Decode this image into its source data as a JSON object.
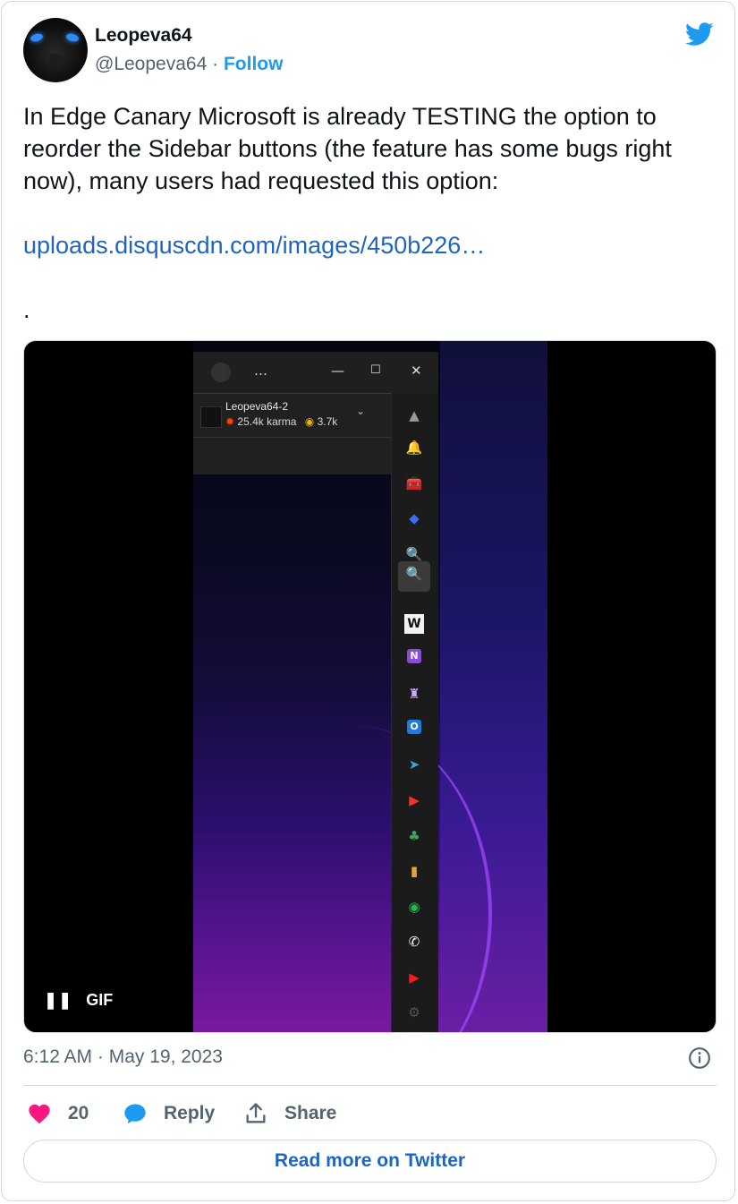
{
  "author": {
    "display_name": "Leopeva64",
    "handle": "@Leopeva64",
    "separator": "·",
    "follow_label": "Follow"
  },
  "tweet": {
    "text_line": "In Edge Canary Microsoft is already TESTING the option to reorder the Sidebar buttons (the feature has some bugs right now), many users had requested this option:",
    "link_text": "uploads.disquscdn.com/images/450b226…",
    "trailing": "."
  },
  "media": {
    "badge": "GIF",
    "pause_glyph": "❚❚",
    "edge": {
      "more_glyph": "…",
      "min_glyph": "—",
      "max_glyph": "☐",
      "close_glyph": "✕",
      "account_name": "Leopeva64-2",
      "karma": "25.4k karma",
      "coins": "3.7k",
      "karma_icon": "✹",
      "coins_icon": "◉",
      "chevron": "⌄",
      "sidebar_icons": [
        {
          "name": "scroll-up-icon",
          "glyph": "▲",
          "color": "#9a9a9a"
        },
        {
          "name": "notification-bell-icon",
          "glyph": "🔔",
          "color": "#2f8bff"
        },
        {
          "name": "tools-icon",
          "glyph": "🧰",
          "color": "#e87a2a"
        },
        {
          "name": "microsoft365-icon",
          "glyph": "◆",
          "color": "#3b6cf0"
        },
        {
          "name": "drag-search-icon",
          "glyph": "🔍",
          "color": "#c9c23a"
        },
        {
          "name": "search-icon",
          "glyph": "🔍",
          "color": "#b08cff"
        },
        {
          "name": "wordle-icon",
          "glyph": "W",
          "color": "#111111"
        },
        {
          "name": "onenote-icon",
          "glyph": "N",
          "color": "#8a4bd6"
        },
        {
          "name": "chess-icon",
          "glyph": "♜",
          "color": "#c9a8ff"
        },
        {
          "name": "outlook-icon",
          "glyph": "O",
          "color": "#1f7ae0"
        },
        {
          "name": "telegram-icon",
          "glyph": "➤",
          "color": "#3aa0e0"
        },
        {
          "name": "youtube-music-icon",
          "glyph": "▶",
          "color": "#ff2d2d"
        },
        {
          "name": "tree-icon",
          "glyph": "♣",
          "color": "#3aa55a"
        },
        {
          "name": "deezer-icon",
          "glyph": "▮",
          "color": "#e8a33a"
        },
        {
          "name": "spotify-icon",
          "glyph": "◉",
          "color": "#1db954"
        },
        {
          "name": "whatsapp-icon",
          "glyph": "✆",
          "color": "#ffffff"
        },
        {
          "name": "youtube-icon",
          "glyph": "▶",
          "color": "#ff1a1a"
        },
        {
          "name": "settings-icon",
          "glyph": "⚙",
          "color": "#555555"
        },
        {
          "name": "add-icon",
          "glyph": "◼",
          "color": "#3a8fd6"
        }
      ]
    }
  },
  "meta": {
    "timestamp": "6:12 AM · May 19, 2023"
  },
  "actions": {
    "likes_count": "20",
    "reply_label": "Reply",
    "share_label": "Share"
  },
  "footer": {
    "read_more_label": "Read more on Twitter"
  },
  "colors": {
    "link": "#1d65c4",
    "follow": "#1d9bf0",
    "like": "#f91880",
    "muted": "#536471"
  }
}
